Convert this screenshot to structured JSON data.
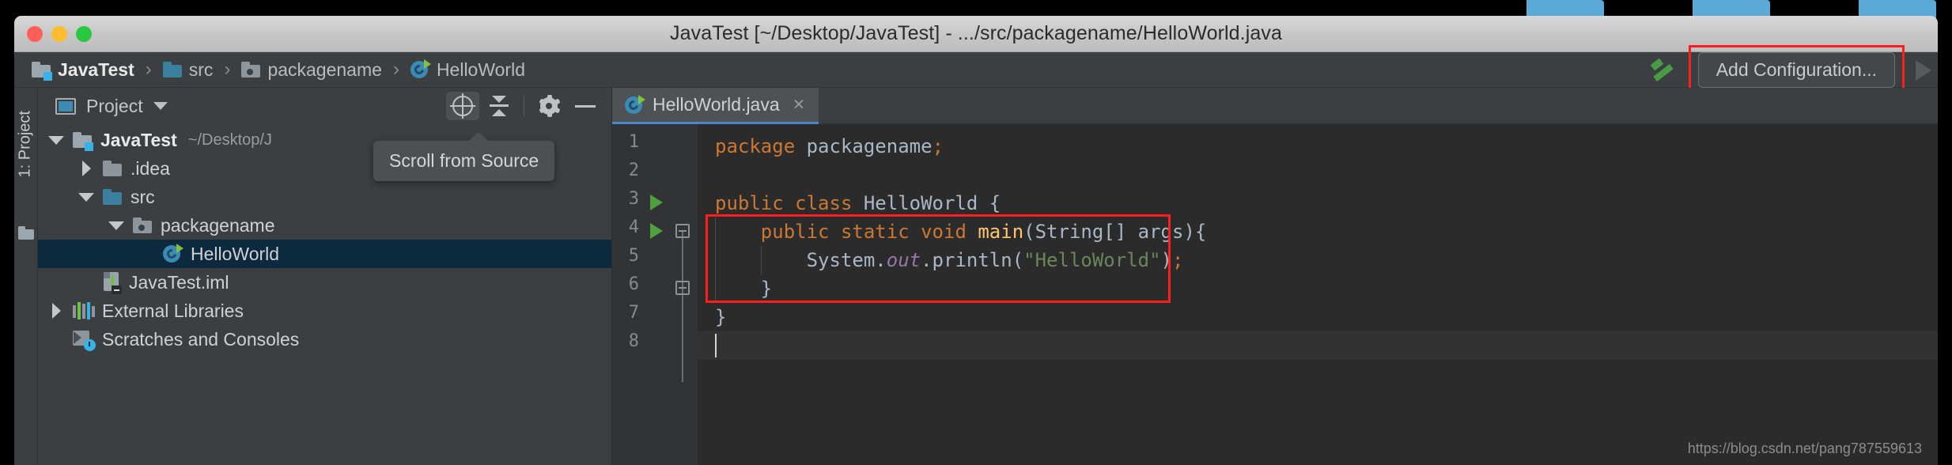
{
  "window": {
    "title": "JavaTest [~/Desktop/JavaTest] - .../src/packagename/HelloWorld.java",
    "controls": {
      "close": "close-button",
      "minimize": "minimize-button",
      "zoom": "zoom-button"
    }
  },
  "navbar": {
    "breadcrumbs": [
      {
        "label": "JavaTest",
        "icon": "module-folder-icon"
      },
      {
        "label": "src",
        "icon": "source-folder-icon"
      },
      {
        "label": "packagename",
        "icon": "package-folder-icon"
      },
      {
        "label": "HelloWorld",
        "icon": "java-class-icon"
      }
    ],
    "separator": "›",
    "build_icon": "hammer-icon",
    "add_configuration_label": "Add Configuration...",
    "run_icon": "run-arrow-icon"
  },
  "toolstrip": {
    "project_label": "1: Project"
  },
  "project_panel": {
    "header_title": "Project",
    "header_icon": "project-view-icon",
    "tools": [
      {
        "name": "scroll-from-source",
        "icon": "crosshair-icon",
        "active": true
      },
      {
        "name": "collapse-all",
        "icon": "collapse-all-icon",
        "active": false
      },
      {
        "name": "settings",
        "icon": "gear-icon",
        "active": false
      },
      {
        "name": "hide",
        "icon": "minus-icon",
        "active": false
      }
    ],
    "tooltip": "Scroll from Source",
    "tree": [
      {
        "label": "JavaTest",
        "sub": "~/Desktop/J",
        "icon": "module-folder-icon",
        "twisty": "down",
        "indent": 0,
        "bold": true,
        "selected": false
      },
      {
        "label": ".idea",
        "sub": "",
        "icon": "plain-folder-icon",
        "twisty": "right",
        "indent": 1,
        "bold": false,
        "selected": false
      },
      {
        "label": "src",
        "sub": "",
        "icon": "source-folder-icon",
        "twisty": "down",
        "indent": 1,
        "bold": false,
        "selected": false
      },
      {
        "label": "packagename",
        "sub": "",
        "icon": "package-folder-icon",
        "twisty": "down",
        "indent": 2,
        "bold": false,
        "selected": false
      },
      {
        "label": "HelloWorld",
        "sub": "",
        "icon": "java-class-icon",
        "twisty": "none",
        "indent": 3,
        "bold": false,
        "selected": true
      },
      {
        "label": "JavaTest.iml",
        "sub": "",
        "icon": "iml-file-icon",
        "twisty": "none",
        "indent": 1,
        "bold": false,
        "selected": false
      },
      {
        "label": "External Libraries",
        "sub": "",
        "icon": "libraries-icon",
        "twisty": "right",
        "indent": 0,
        "bold": false,
        "selected": false
      },
      {
        "label": "Scratches and Consoles",
        "sub": "",
        "icon": "scratches-icon",
        "twisty": "none",
        "indent": 0,
        "bold": false,
        "selected": false
      }
    ]
  },
  "editor": {
    "tab": {
      "label": "HelloWorld.java",
      "icon": "java-class-icon",
      "close": "×"
    },
    "line_numbers": [
      "1",
      "2",
      "3",
      "4",
      "5",
      "6",
      "7",
      "8"
    ],
    "current_line": 8,
    "lines": [
      {
        "n": 1,
        "tokens": [
          {
            "t": "package",
            "c": "kw"
          },
          {
            "t": " ",
            "c": "id"
          },
          {
            "t": "packagename",
            "c": "id"
          },
          {
            "t": ";",
            "c": "semi"
          }
        ]
      },
      {
        "n": 2,
        "tokens": []
      },
      {
        "n": 3,
        "tokens": [
          {
            "t": "public",
            "c": "kw"
          },
          {
            "t": " ",
            "c": "id"
          },
          {
            "t": "class",
            "c": "kw"
          },
          {
            "t": " ",
            "c": "id"
          },
          {
            "t": "HelloWorld",
            "c": "id"
          },
          {
            "t": " {",
            "c": "id"
          }
        ]
      },
      {
        "n": 4,
        "tokens": [
          {
            "t": "    ",
            "c": "id"
          },
          {
            "t": "public",
            "c": "kw"
          },
          {
            "t": " ",
            "c": "id"
          },
          {
            "t": "static",
            "c": "kw"
          },
          {
            "t": " ",
            "c": "id"
          },
          {
            "t": "void",
            "c": "kw"
          },
          {
            "t": " ",
            "c": "id"
          },
          {
            "t": "main",
            "c": "meth"
          },
          {
            "t": "(String[] args){",
            "c": "id"
          }
        ]
      },
      {
        "n": 5,
        "tokens": [
          {
            "t": "        System.",
            "c": "id"
          },
          {
            "t": "out",
            "c": "fld"
          },
          {
            "t": ".println(",
            "c": "id"
          },
          {
            "t": "\"HelloWorld\"",
            "c": "str"
          },
          {
            "t": ")",
            "c": "id"
          },
          {
            "t": ";",
            "c": "semi"
          }
        ]
      },
      {
        "n": 6,
        "tokens": [
          {
            "t": "    }",
            "c": "id"
          }
        ]
      },
      {
        "n": 7,
        "tokens": [
          {
            "t": "}",
            "c": "id"
          }
        ]
      },
      {
        "n": 8,
        "tokens": []
      }
    ],
    "run_markers": [
      3,
      4
    ],
    "fold_markers": [
      4,
      6
    ]
  },
  "watermark": "https://blog.csdn.net/pang787559613",
  "colors": {
    "accent": "#4a88c7",
    "annotation": "#ff1d1d",
    "selection": "#0d293e",
    "keyword": "#cc7832",
    "string": "#6a8759",
    "method": "#ffc66d",
    "field": "#9876aa",
    "identifier": "#a9b7c6"
  }
}
